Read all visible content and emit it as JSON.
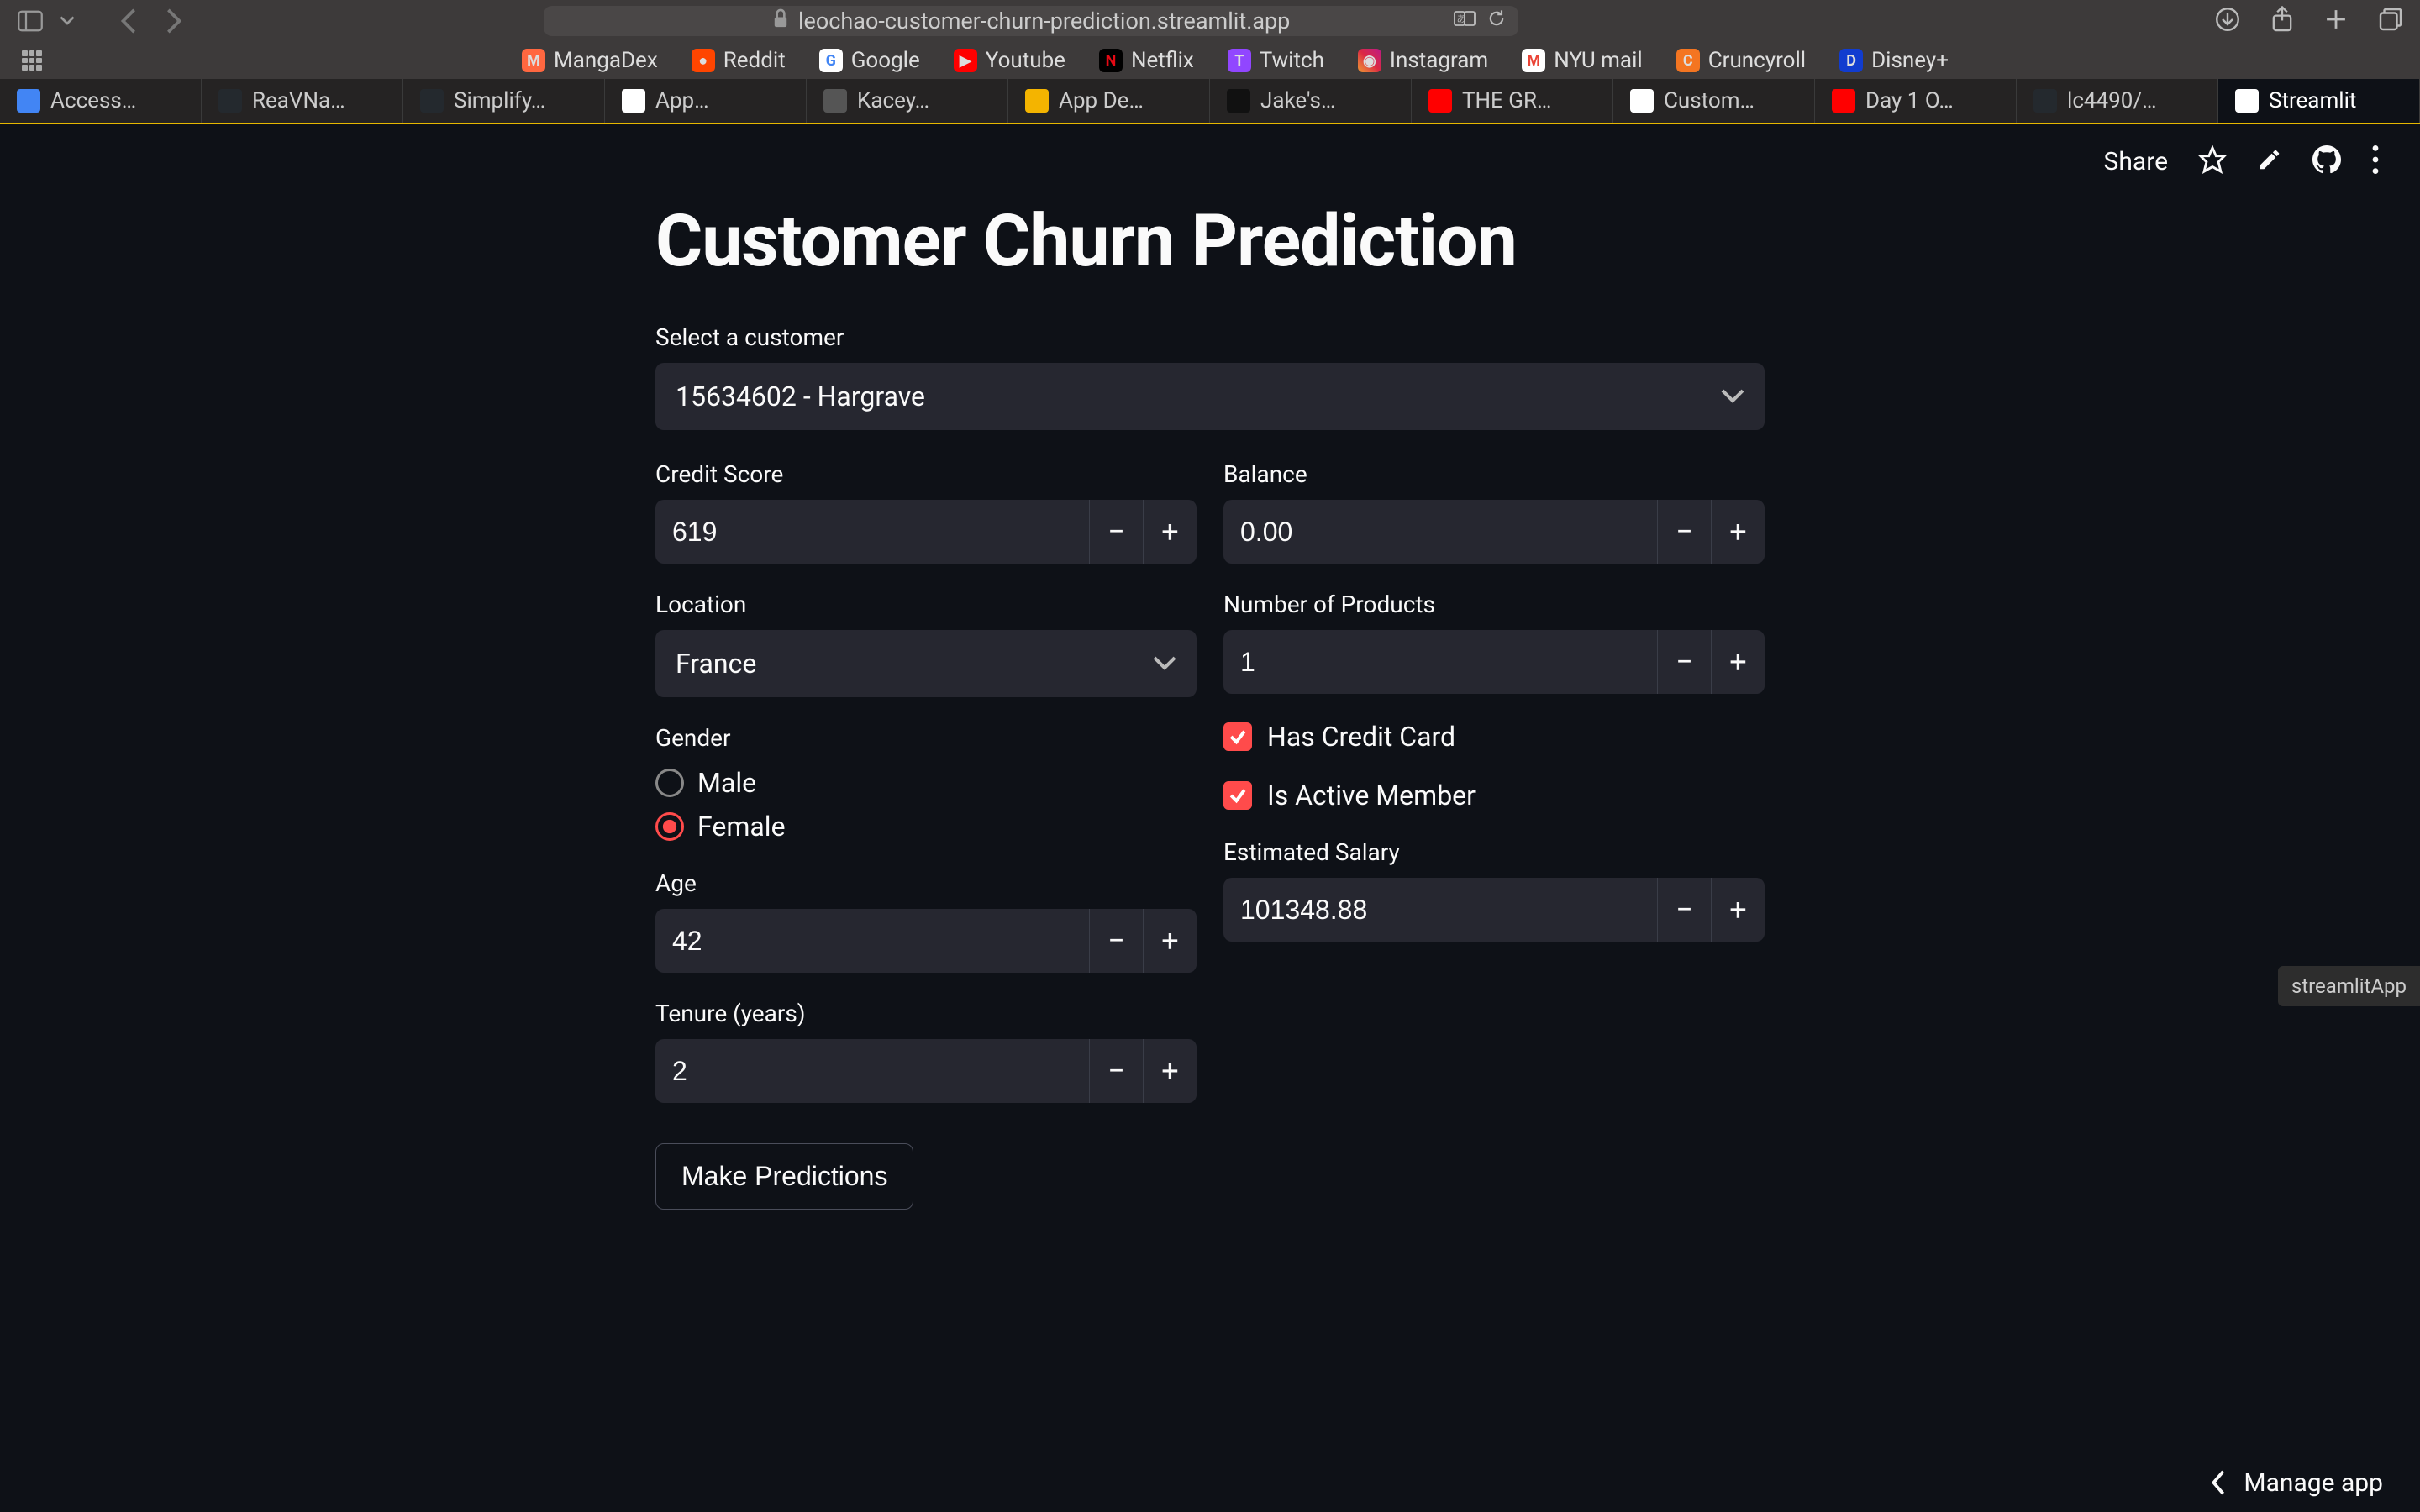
{
  "browser": {
    "url": "leochao-customer-churn-prediction.streamlit.app",
    "bookmarks": [
      {
        "label": "MangaDex",
        "color": "#ff6740"
      },
      {
        "label": "Reddit",
        "color": "#ff4500"
      },
      {
        "label": "Google",
        "color": "#fff"
      },
      {
        "label": "Youtube",
        "color": "#ff0000"
      },
      {
        "label": "Netflix",
        "color": "#e50914"
      },
      {
        "label": "Twitch",
        "color": "#9146ff"
      },
      {
        "label": "Instagram",
        "color": "#e1306c"
      },
      {
        "label": "NYU mail",
        "color": "#fff"
      },
      {
        "label": "Cruncyroll",
        "color": "#f47521"
      },
      {
        "label": "Disney+",
        "color": "#113ccf"
      }
    ],
    "tabs": [
      {
        "label": "Access…",
        "icon_bg": "#4285f4"
      },
      {
        "label": "ReaVNa…",
        "icon_bg": "#24292e"
      },
      {
        "label": "Simplify…",
        "icon_bg": "#24292e"
      },
      {
        "label": "App…",
        "icon_bg": "#fff"
      },
      {
        "label": "Kacey…",
        "icon_bg": "#555"
      },
      {
        "label": "App De…",
        "icon_bg": "#f4b400"
      },
      {
        "label": "Jake's…",
        "icon_bg": "#111"
      },
      {
        "label": "THE GR…",
        "icon_bg": "#ff0000"
      },
      {
        "label": "Custom…",
        "icon_bg": "#fff"
      },
      {
        "label": "Day 1 O…",
        "icon_bg": "#ff0000"
      },
      {
        "label": "lc4490/…",
        "icon_bg": "#24292e"
      },
      {
        "label": "Streamlit",
        "icon_bg": "#fff",
        "active": true
      }
    ]
  },
  "app": {
    "share": "Share",
    "title": "Customer Churn Prediction",
    "customer": {
      "label": "Select a customer",
      "value": "15634602 - Hargrave"
    },
    "left": {
      "credit_score": {
        "label": "Credit Score",
        "value": "619"
      },
      "location": {
        "label": "Location",
        "value": "France"
      },
      "gender": {
        "label": "Gender",
        "male": "Male",
        "female": "Female",
        "selected": "Female"
      },
      "age": {
        "label": "Age",
        "value": "42"
      },
      "tenure": {
        "label": "Tenure (years)",
        "value": "2"
      }
    },
    "right": {
      "balance": {
        "label": "Balance",
        "value": "0.00"
      },
      "num_products": {
        "label": "Number of Products",
        "value": "1"
      },
      "has_credit_card": {
        "label": "Has Credit Card",
        "checked": true
      },
      "is_active": {
        "label": "Is Active Member",
        "checked": true
      },
      "salary": {
        "label": "Estimated Salary",
        "value": "101348.88"
      }
    },
    "predict_button": "Make Predictions",
    "side_badge": "streamlitApp",
    "manage_app": "Manage app"
  }
}
